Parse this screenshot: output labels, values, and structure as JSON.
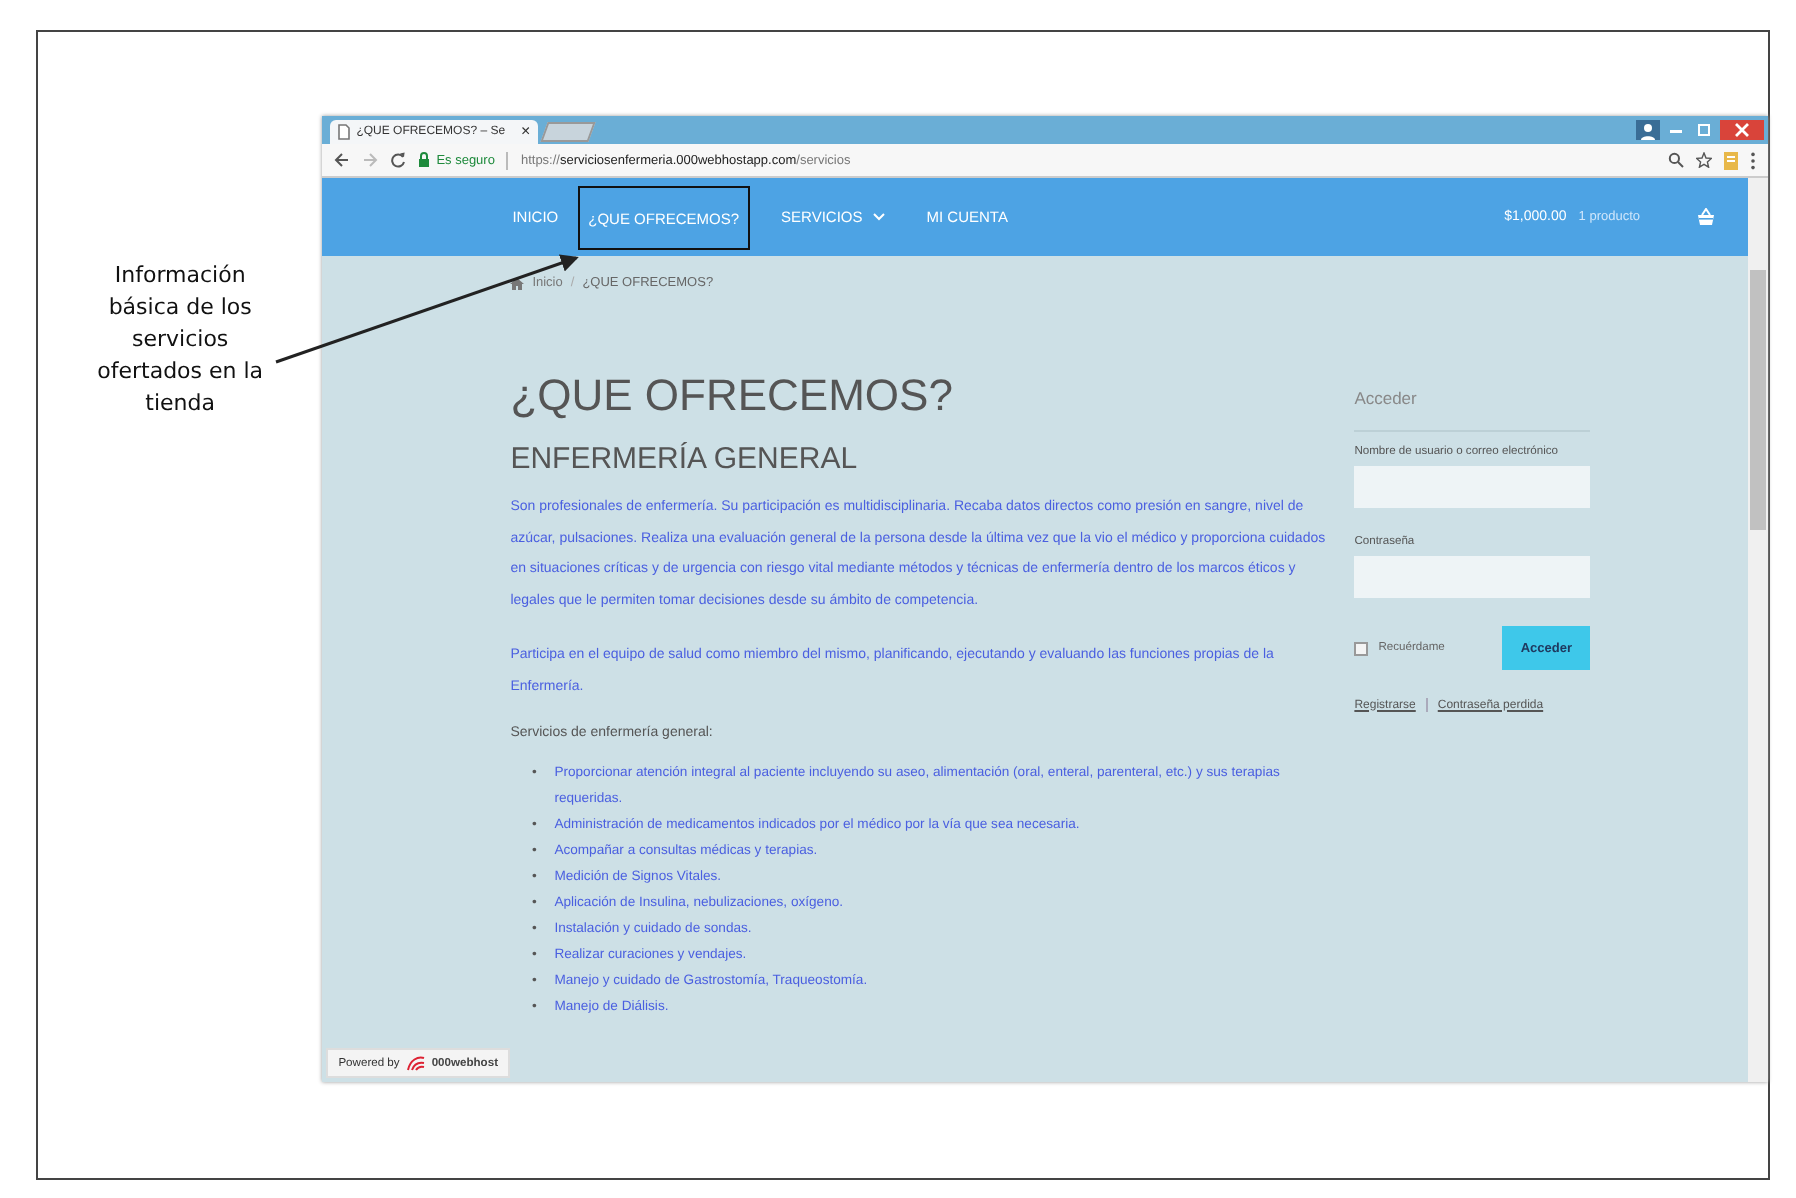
{
  "annotation": {
    "text": "Información básica de los servicios ofertados en la tienda"
  },
  "browser": {
    "tabs": [
      {
        "title": "¿QUE OFRECEMOS? – Se",
        "close": "×",
        "selected": true
      }
    ],
    "security_label": "Es seguro",
    "url": {
      "scheme": "https://",
      "host": "serviciosenfermeria.000webhostapp.com",
      "path": "/servicios"
    }
  },
  "nav": {
    "items": [
      {
        "label": "INICIO",
        "highlighted": false,
        "dropdown": false
      },
      {
        "label": "¿QUE OFRECEMOS?",
        "highlighted": true,
        "dropdown": false
      },
      {
        "label": "SERVICIOS",
        "highlighted": false,
        "dropdown": true
      },
      {
        "label": "MI CUENTA",
        "highlighted": false,
        "dropdown": false
      }
    ],
    "cart": {
      "total": "$1,000.00",
      "count": "1 producto"
    }
  },
  "breadcrumb": [
    "Inicio",
    "¿QUE OFRECEMOS?"
  ],
  "breadcrumb_separator": "/",
  "page": {
    "title": "¿QUE OFRECEMOS?",
    "subtitle": "ENFERMERÍA GENERAL",
    "paragraphs": [
      "Son profesionales de enfermería. Su participación es multidisciplinaria. Recaba datos directos como presión en sangre, nivel de azúcar, pulsaciones. Realiza una evaluación general de la persona desde la última vez que la vio el médico y proporciona cuidados en situaciones críticas y de urgencia con riesgo vital mediante métodos y técnicas de enfermería dentro de los marcos éticos y legales que le permiten tomar decisiones desde su ámbito de competencia.",
      "Participa en el equipo de salud como miembro del mismo, planificando, ejecutando y evaluando las funciones propias de la Enfermería."
    ],
    "list_heading": "Servicios de enfermería general:",
    "bullet": "•",
    "services": [
      "Proporcionar atención integral al paciente incluyendo su aseo, alimentación (oral, enteral, parenteral, etc.) y sus terapias requeridas.",
      "Administración de medicamentos indicados por el médico por la vía que sea necesaria.",
      "Acompañar a consultas médicas y terapias.",
      "Medición de Signos Vitales.",
      "Aplicación de Insulina, nebulizaciones, oxígeno.",
      "Instalación y cuidado de sondas.",
      "Realizar curaciones y vendajes.",
      "Manejo y cuidado de Gastrostomía, Traqueostomía.",
      "Manejo de Diálisis."
    ]
  },
  "login": {
    "title": "Acceder",
    "username_label": "Nombre de usuario o correo electrónico",
    "password_label": "Contraseña",
    "remember": {
      "label": "Recuérdame",
      "checked": false
    },
    "submit": "Acceder",
    "links": [
      "Registrarse",
      "Contraseña perdida"
    ]
  },
  "badge": {
    "prefix": "Powered by",
    "brand": "000webhost"
  }
}
